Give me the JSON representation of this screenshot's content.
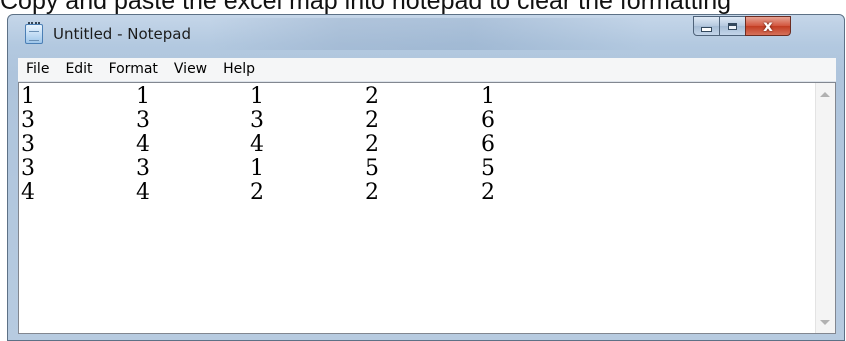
{
  "caption": {
    "text": "Copy and paste the excel map into notepad to clear the formatting"
  },
  "window": {
    "title": "Untitled - Notepad",
    "app_icon": "notepad-icon",
    "controls": {
      "minimize_icon": "minimize-icon",
      "maximize_icon": "maximize-icon",
      "close_icon": "close-icon",
      "close_glyph": "x"
    }
  },
  "menu": [
    "File",
    "Edit",
    "Format",
    "View",
    "Help"
  ],
  "editor": {
    "rows": [
      [
        "1",
        "1",
        "1",
        "2",
        "1"
      ],
      [
        "3",
        "3",
        "3",
        "2",
        "6"
      ],
      [
        "3",
        "4",
        "4",
        "2",
        "6"
      ],
      [
        "3",
        "3",
        "1",
        "5",
        "5"
      ],
      [
        "4",
        "4",
        "2",
        "2",
        "2"
      ]
    ]
  },
  "scrollbar": {
    "up_icon": "scroll-up-icon",
    "down_icon": "scroll-down-icon"
  }
}
